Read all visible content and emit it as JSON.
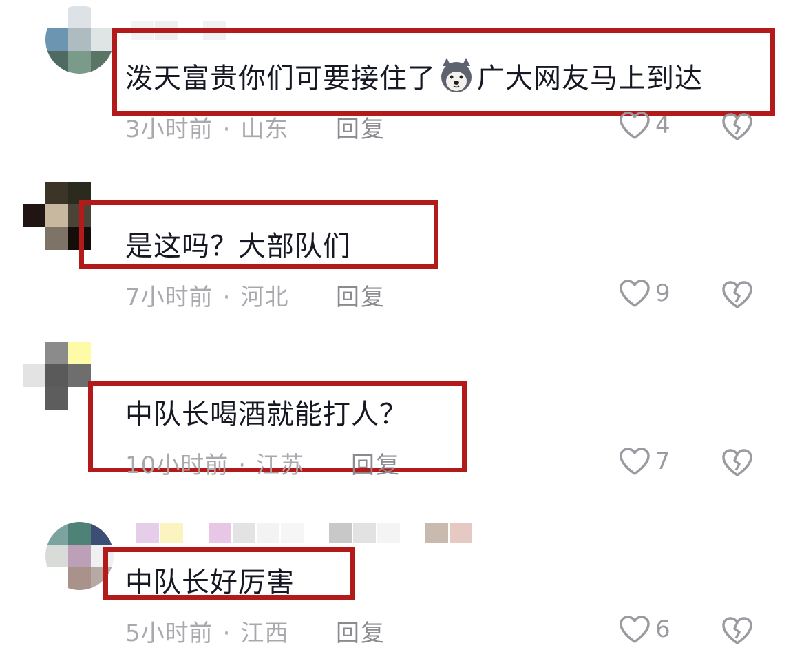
{
  "comments": [
    {
      "text": "泼天富贵你们可要接住了",
      "text_after": "广大网友马上到达",
      "emoji": "husky-dog-face-emoji",
      "time": "3小时前",
      "location": "山东",
      "reply_label": "回复",
      "likes": "4",
      "avatar_colors": [
        "#ffffff",
        "#dde2e6",
        "#ffffff",
        "#6c95b2",
        "#aebcc2",
        "#dfe5e5",
        "#4f6a62",
        "#7a9a8a",
        "#5a7565"
      ]
    },
    {
      "text": "是这吗？大部队们",
      "time": "7小时前",
      "location": "河北",
      "reply_label": "回复",
      "likes": "9",
      "avatar_colors": [
        "#ffffff",
        "#3d3428",
        "#2b2a1e",
        "#211514",
        "#c8b89f",
        "#4c4338",
        "#ffffff",
        "#7e7367",
        "#140d09"
      ]
    },
    {
      "text": "中队长喝酒就能打人？",
      "time": "10小时前",
      "location": "江苏",
      "reply_label": "回复",
      "likes": "7",
      "avatar_colors": [
        "#ffffff",
        "#8b8b8b",
        "#fdfba8",
        "#e3e3e3",
        "#5a5a5a",
        "#6e6e6e",
        "#ffffff",
        "#5d5d5d",
        "#ffffff"
      ]
    },
    {
      "text": "中队长好厉害",
      "time": "5小时前",
      "location": "江西",
      "reply_label": "回复",
      "likes": "6",
      "avatar_colors": [
        "#7ba3a0",
        "#4f8276",
        "#3c4d76",
        "#d9dbd9",
        "#bca0b7",
        "#f0f0f2",
        "#ffffff",
        "#a8928a",
        "#b7a9a4"
      ]
    }
  ],
  "colors": {
    "highlight": "#b31b1b",
    "text": "#161823",
    "meta": "#a8a8ad",
    "reply": "#8a8a90",
    "icon": "#9a9aa0"
  }
}
